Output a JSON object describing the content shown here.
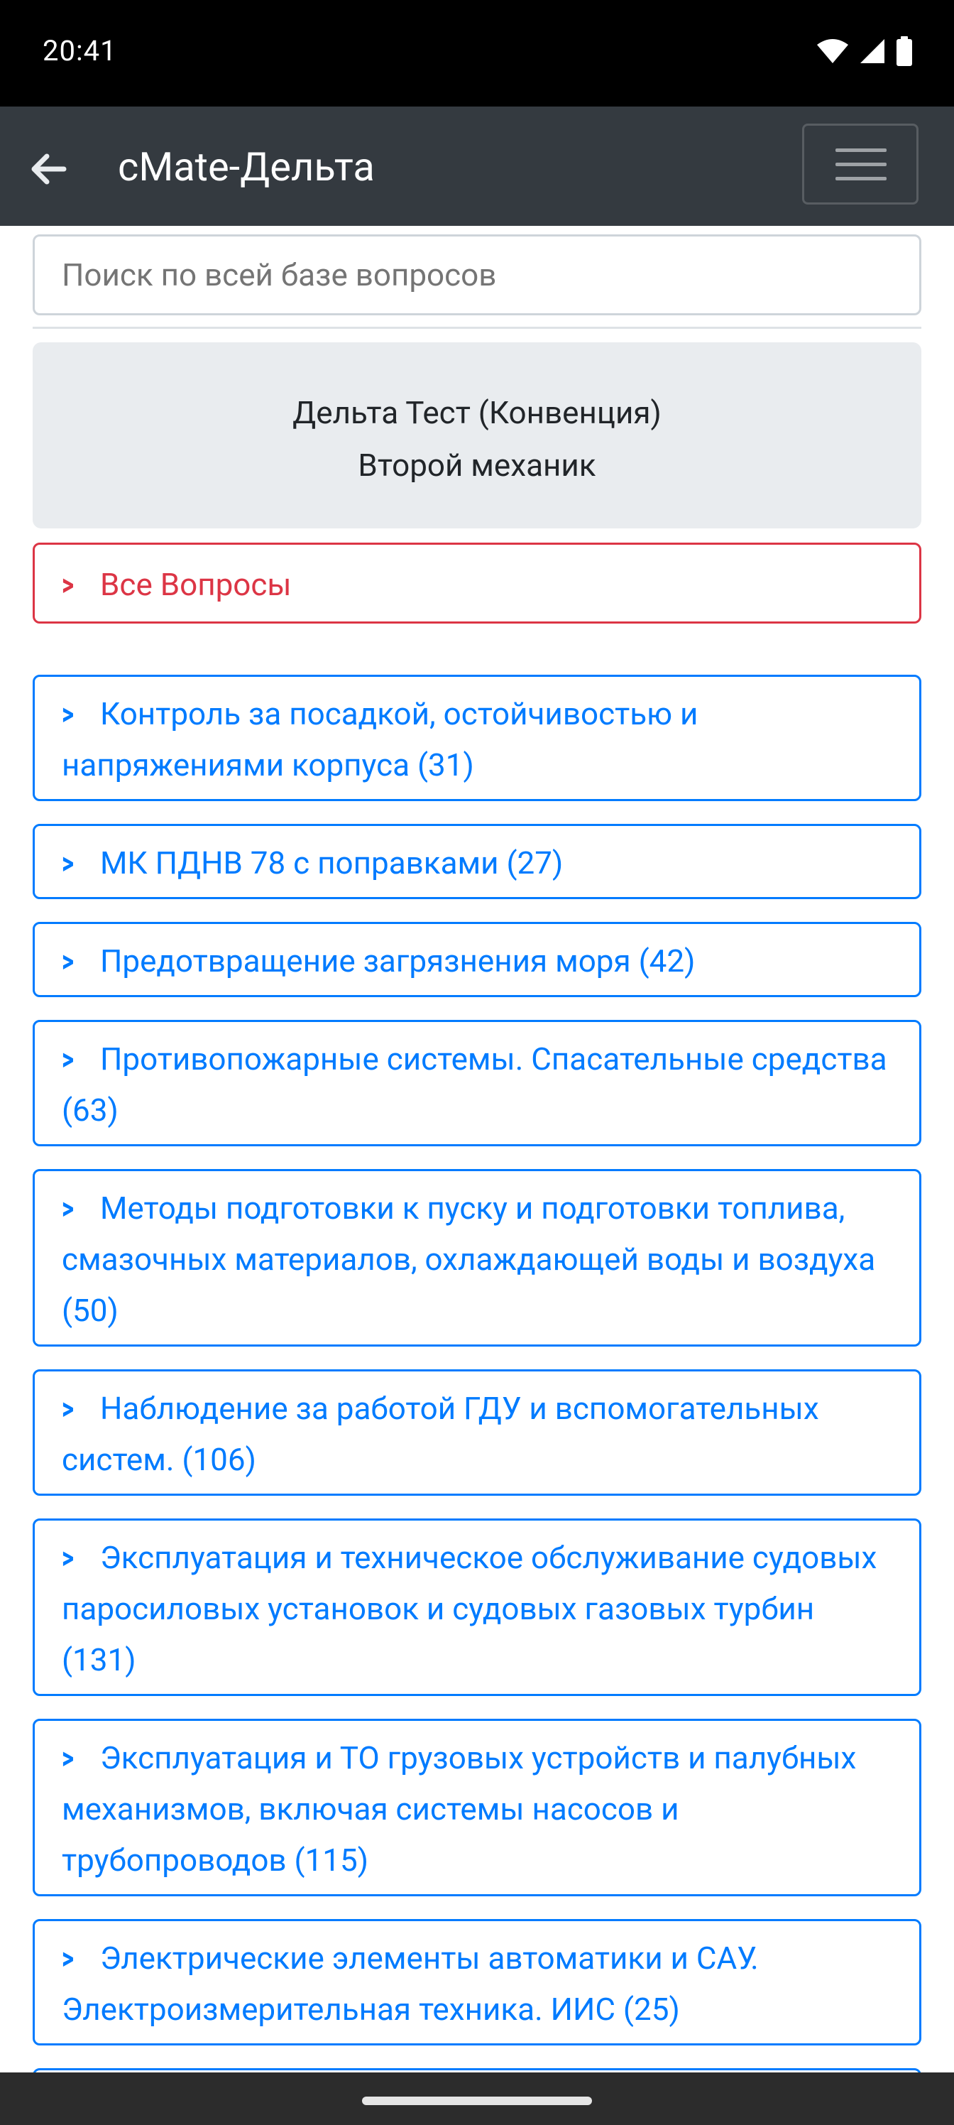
{
  "status_bar": {
    "time": "20:41",
    "icons": [
      "wifi-icon",
      "signal-icon",
      "battery-icon"
    ]
  },
  "navbar": {
    "title": "cMate-Дельта",
    "back_icon": "arrow-left-icon",
    "menu_icon": "hamburger-menu-icon"
  },
  "search": {
    "placeholder": "Поиск по всей базе вопросов"
  },
  "info_panel": {
    "line1": "Дельта Тест (Конвенция)",
    "line2": "Второй механик"
  },
  "all_questions": {
    "label": "Все Вопросы",
    "color": "#dc3545"
  },
  "categories": [
    {
      "label": "Контроль за посадкой, остойчивостью и напряжениями корпуса (31)"
    },
    {
      "label": "МК ПДНВ 78 с поправками (27)"
    },
    {
      "label": "Предотвращение загрязнения моря (42)"
    },
    {
      "label": "Противопожарные системы. Спасательные средства (63)"
    },
    {
      "label": "Методы подготовки к пуску и подготовки топлива, смазочных материалов, охлаждающей воды и воздуха (50)"
    },
    {
      "label": "Наблюдение за работой ГДУ и вспомогательных систем. (106)"
    },
    {
      "label": "Эксплуатация и техническое обслуживание судовых паросиловых установок и судовых газовых турбин (131)"
    },
    {
      "label": "Эксплуатация и ТО грузовых устройств и палубных механизмов, включая системы насосов и трубопроводов (115)"
    },
    {
      "label": "Электрические элементы автоматики и САУ. Электроизмерительная техника. ИИС (25)"
    }
  ],
  "colors": {
    "navbar": "#343a40",
    "category_accent": "#007bff",
    "panel_bg": "#e9ecef"
  }
}
